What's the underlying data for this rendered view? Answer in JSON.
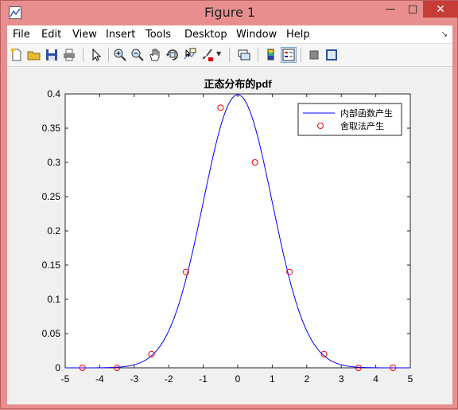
{
  "window": {
    "title": "Figure 1"
  },
  "menu": [
    "File",
    "Edit",
    "View",
    "Insert",
    "Tools",
    "Desktop",
    "Window",
    "Help"
  ],
  "toolbar": [
    "new-figure",
    "open-file",
    "save",
    "print",
    "edit-plot",
    "zoom-in",
    "zoom-out",
    "pan",
    "rotate-3d",
    "data-cursor",
    "brush",
    "link-plot",
    "colorbar",
    "legend",
    "hide-plot-tools",
    "show-plot-tools"
  ],
  "colors": {
    "curve": "#0000ff",
    "markers": "#ff0000",
    "close": "#c73c36",
    "frame": "#e88e8e"
  },
  "chart_data": {
    "type": "line",
    "title": "正态分布的pdf",
    "xlim": [
      -5,
      5
    ],
    "ylim": [
      0,
      0.4
    ],
    "xticks": [
      -5,
      -4,
      -3,
      -2,
      -1,
      0,
      1,
      2,
      3,
      4,
      5
    ],
    "yticks": [
      0,
      0.05,
      0.1,
      0.15,
      0.2,
      0.25,
      0.3,
      0.35,
      0.4
    ],
    "series": [
      {
        "name": "内部函数产生",
        "style": "line",
        "function": "normal-pdf",
        "mean": 0,
        "sd": 1
      },
      {
        "name": "舍取法产生",
        "style": "circle-marker",
        "x": [
          -4.5,
          -3.5,
          -2.5,
          -1.5,
          -0.5,
          0.5,
          1.5,
          2.5,
          3.5,
          4.5
        ],
        "y": [
          0,
          0,
          0.02,
          0.14,
          0.38,
          0.3,
          0.14,
          0.02,
          0,
          0
        ]
      }
    ],
    "legend": "top-right",
    "grid": false
  }
}
